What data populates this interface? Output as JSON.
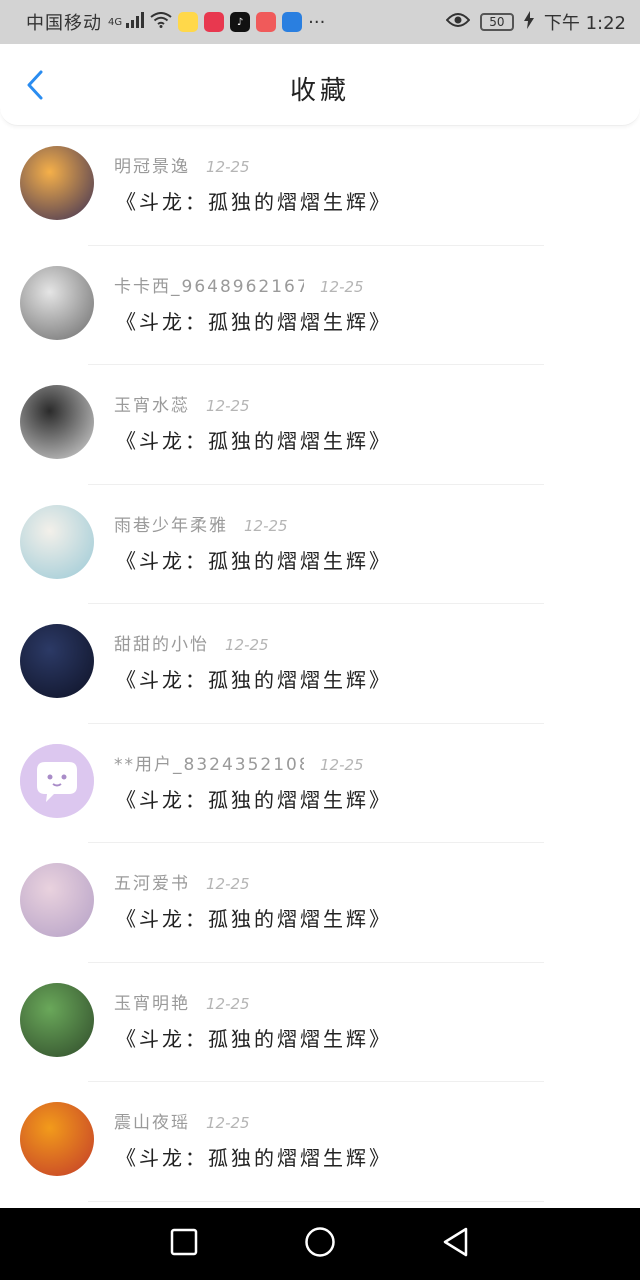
{
  "status_bar": {
    "carrier": "中国移动",
    "network": "4G",
    "battery": "50",
    "time": "下午 1:22",
    "icons": [
      "signal-icon",
      "wifi-icon",
      "app-icon-1",
      "app-icon-2",
      "douyin-icon",
      "app-icon-4",
      "app-icon-5",
      "more-icon",
      "eye-icon",
      "charging-icon"
    ],
    "more": "···"
  },
  "header": {
    "title": "收藏",
    "back_icon": "chevron-left-icon"
  },
  "accent_color": "#2a8cf0",
  "items": [
    {
      "user": "明冠景逸",
      "date": "12-25",
      "title": "《斗龙：孤独的熠熠生辉》",
      "avatar_colors": [
        "#f5b04a",
        "#3a2e56"
      ]
    },
    {
      "user": "卡卡西_9648962167…",
      "date": "12-25",
      "title": "《斗龙：孤独的熠熠生辉》",
      "avatar_colors": [
        "#e5e5e5",
        "#6a6a6a"
      ]
    },
    {
      "user": "玉宵水蕊",
      "date": "12-25",
      "title": "《斗龙：孤独的熠熠生辉》",
      "avatar_colors": [
        "#2b2b2b",
        "#d9d9d9"
      ]
    },
    {
      "user": "雨巷少年柔雅",
      "date": "12-25",
      "title": "《斗龙：孤独的熠熠生辉》",
      "avatar_colors": [
        "#f3f0ea",
        "#9ac9d6"
      ]
    },
    {
      "user": "甜甜的小怡",
      "date": "12-25",
      "title": "《斗龙：孤独的熠熠生辉》",
      "avatar_colors": [
        "#2c3a66",
        "#0e1226"
      ]
    },
    {
      "user": "**用户_8324352108…",
      "date": "12-25",
      "title": "《斗龙：孤独的熠熠生辉》",
      "avatar_colors": [
        "#dcc7ef",
        "#ffffff"
      ]
    },
    {
      "user": "五河爱书",
      "date": "12-25",
      "title": "《斗龙：孤独的熠熠生辉》",
      "avatar_colors": [
        "#e9d2de",
        "#b4a0c6"
      ]
    },
    {
      "user": "玉宵明艳",
      "date": "12-25",
      "title": "《斗龙：孤独的熠熠生辉》",
      "avatar_colors": [
        "#6aa85a",
        "#2f4a2a"
      ]
    },
    {
      "user": "震山夜瑶",
      "date": "12-25",
      "title": "《斗龙：孤独的熠熠生辉》",
      "avatar_colors": [
        "#f29b1b",
        "#c23a2a"
      ]
    }
  ],
  "nav_bar": {
    "icons": [
      "recent-apps-icon",
      "home-icon",
      "back-icon"
    ]
  }
}
